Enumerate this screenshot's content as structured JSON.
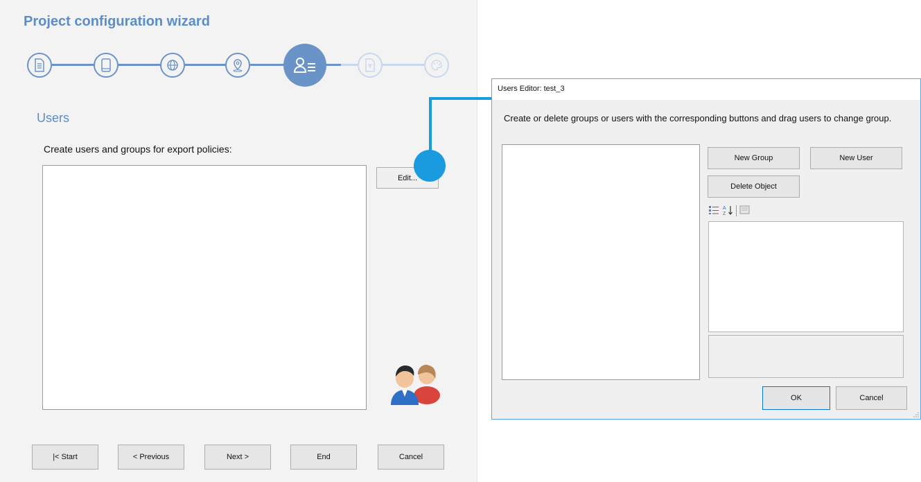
{
  "wizard": {
    "title": "Project configuration wizard",
    "steps": [
      {
        "icon": "document-list-icon",
        "state": "done"
      },
      {
        "icon": "mobile-device-icon",
        "state": "done"
      },
      {
        "icon": "globe-icon",
        "state": "done"
      },
      {
        "icon": "location-pin-icon",
        "state": "done"
      },
      {
        "icon": "users-list-icon",
        "state": "active"
      },
      {
        "icon": "document-edit-icon",
        "state": "pending"
      },
      {
        "icon": "palette-icon",
        "state": "pending"
      }
    ],
    "section_title": "Users",
    "instruction": "Create users and groups for export policies:",
    "edit_button": "Edit...",
    "nav": {
      "start": "|< Start",
      "previous": "< Previous",
      "next": "Next >",
      "end": "End",
      "cancel": "Cancel"
    }
  },
  "dialog": {
    "title": "Users Editor: test_3",
    "description": "Create or delete groups or users with the corresponding buttons and drag users to change group.",
    "new_group": "New Group",
    "new_user": "New User",
    "delete_object": "Delete Object",
    "ok": "OK",
    "cancel": "Cancel"
  },
  "colors": {
    "accent": "#5b8dc7",
    "step_active": "#6a93c7",
    "step_pending": "#c9d8ec",
    "callout": "#1a9be0"
  }
}
